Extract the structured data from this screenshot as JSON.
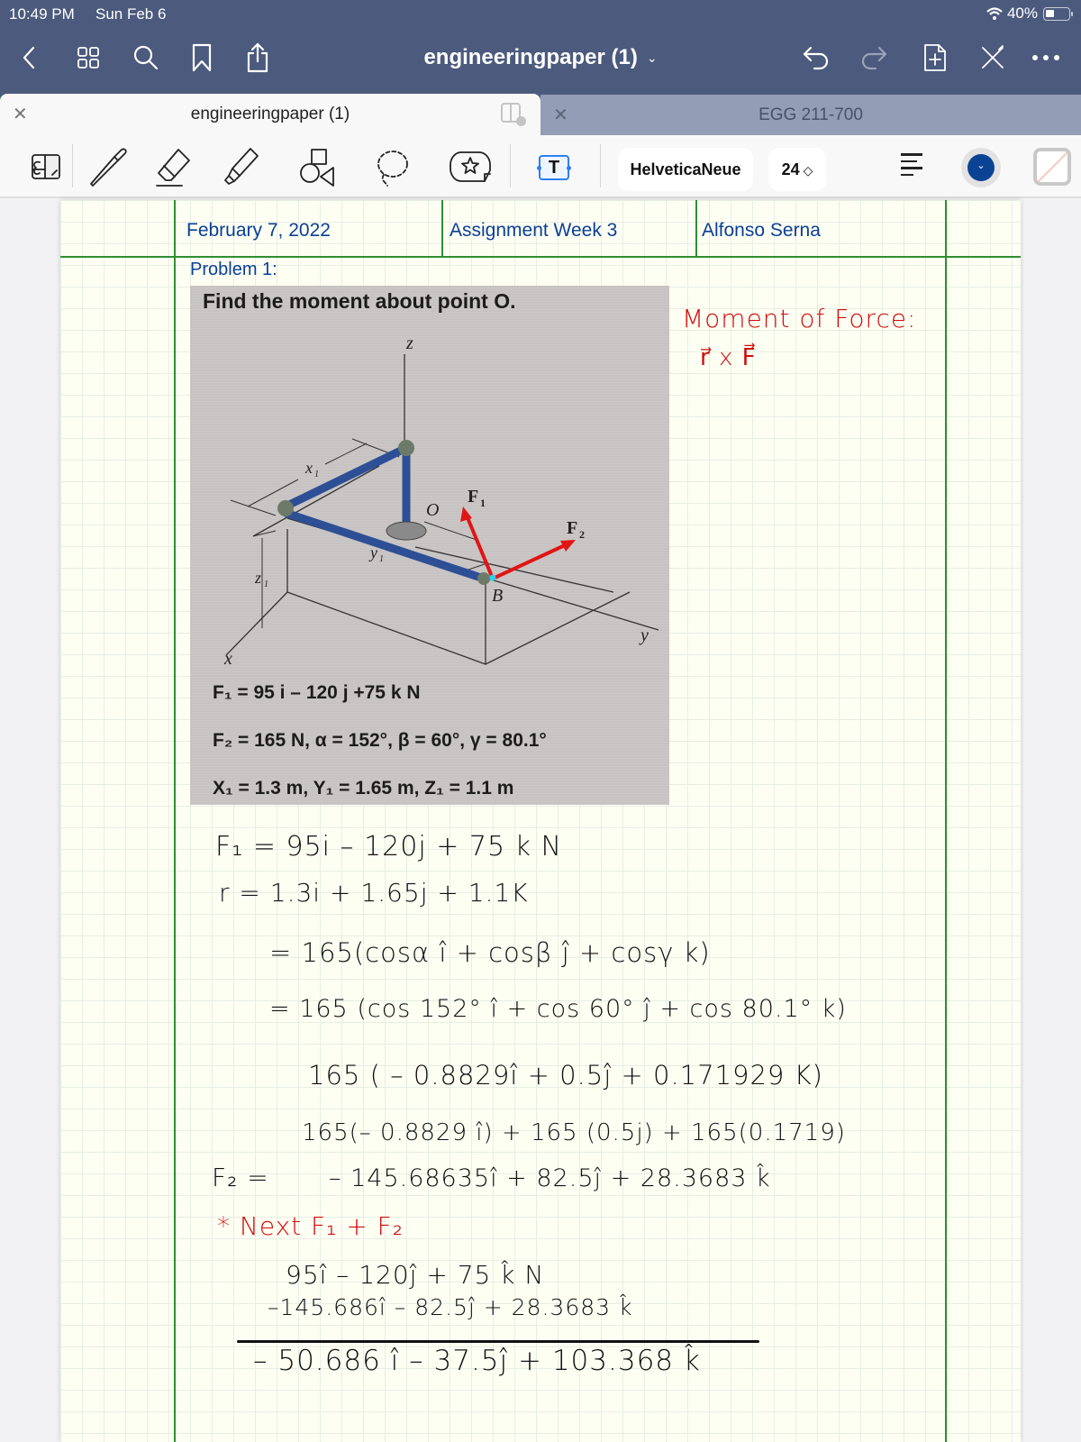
{
  "status_bar": {
    "time": "10:49 PM",
    "date": "Sun Feb 6",
    "battery": "40%",
    "icons": [
      "wifi-icon",
      "battery-icon"
    ]
  },
  "nav": {
    "document_title": "engineeringpaper (1)",
    "title_menu_icon": "chevron-down-icon",
    "left_icons": [
      "back-icon",
      "thumbnails-icon",
      "search-icon",
      "bookmark-icon",
      "share-icon"
    ],
    "right_icons": [
      "undo-icon",
      "redo-icon",
      "add-page-icon",
      "close-pen-icon",
      "more-icon"
    ]
  },
  "tabs": [
    {
      "label": "engineeringpaper (1)",
      "active": true
    },
    {
      "label": "EGG 211-700",
      "active": false
    }
  ],
  "toolbar": {
    "tools": [
      "read-only-mode-icon",
      "pen-icon",
      "eraser-icon",
      "highlighter-icon",
      "shapes-icon",
      "lasso-icon",
      "elements-sticker-icon",
      "text-tool-icon"
    ],
    "text_tool_label": "T",
    "font_name": "HelveticaNeue",
    "font_size": "24",
    "text_color": "#0a4394"
  },
  "page": {
    "header": {
      "date": "February 7, 2022",
      "assignment": "Assignment Week 3",
      "name": "Alfonso Serna"
    },
    "problem_label": "Problem 1:",
    "problem_image": {
      "question": "Find the moment about point O.",
      "diagram_labels": {
        "z_axis": "z",
        "y_axis": "y",
        "x_axis": "x",
        "origin": "O",
        "point_b": "B",
        "force1": "F",
        "force1_sub": "1",
        "force2": "F",
        "force2_sub": "2",
        "dim_x": "x",
        "dim_x_sub": "1",
        "dim_y": "y",
        "dim_y_sub": "1",
        "dim_z": "z",
        "dim_z_sub": "1"
      },
      "given": [
        "F₁ = 95 i – 120 j +75 k N",
        "F₂ = 165 N, α = 152°, β = 60°, γ = 80.1°",
        "X₁ = 1.3 m, Y₁ = 1.65 m, Z₁ = 1.1 m"
      ]
    },
    "notes_red": {
      "title": "Moment of Force:",
      "formula": "r⃗ x F⃗"
    },
    "work": {
      "f1_line": "F₁ = 95i – 120j + 75 k N",
      "r_line": "r =   1.3i + 1.65j + 1.1K",
      "f2_eq1": "=    165(cosα î + cosβ ĵ + cosγ k)",
      "f2_eq2": "=    165  (cos 152° î + cos 60° ĵ + cos 80.1° k)",
      "f2_eq3": "165  ( – 0.8829î + 0.5ĵ + 0.171929 K)",
      "f2_eq4": "165(– 0.8829 î) + 165 (0.5j) + 165(0.1719)",
      "f2_label": "F₂  =",
      "f2_result": "– 145.68635î + 82.5ĵ + 28.3683 k̂",
      "next_step": "* Next  F₁ + F₂",
      "sum_row1": "95î – 120ĵ + 75 k̂  N",
      "sum_row2": "–145.686î  –  82.5ĵ + 28.3683 k̂",
      "sum_total": "– 50.686 î – 37.5ĵ + 103.368 k̂"
    }
  }
}
